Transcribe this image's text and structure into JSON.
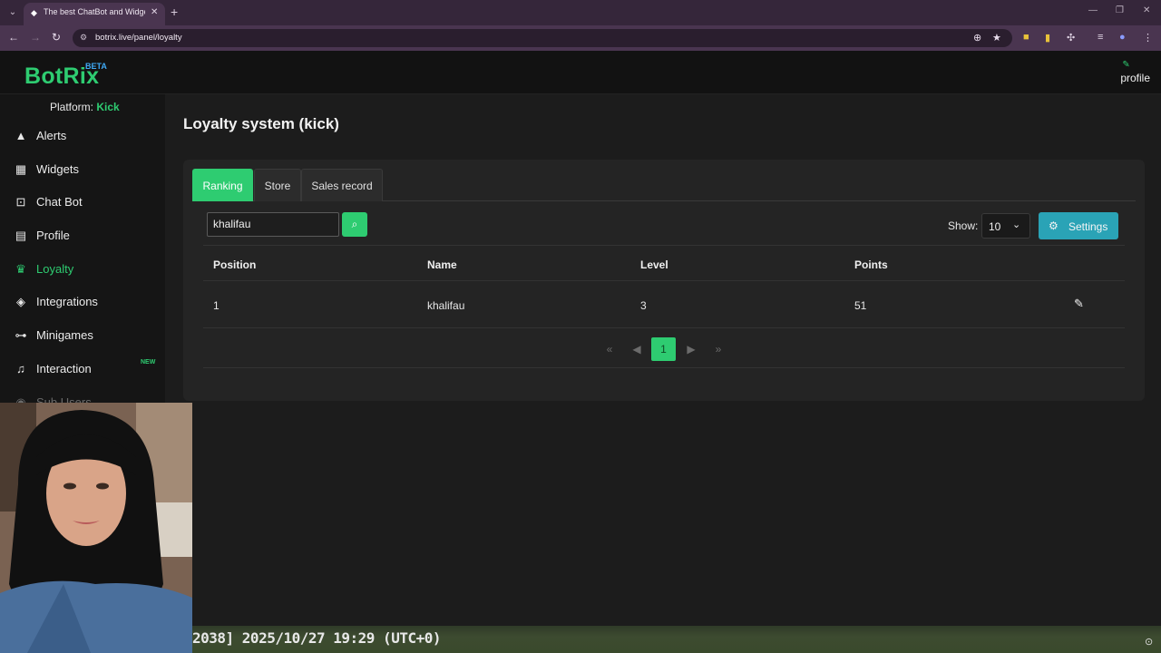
{
  "browser": {
    "tab_title": "The best ChatBot and Widgets",
    "url": "botrix.live/panel/loyalty"
  },
  "app": {
    "logo": "BotRix",
    "beta": "BETA",
    "profile_label": "profile"
  },
  "sidebar": {
    "platform_label": "Platform:",
    "platform_value": "Kick",
    "items": [
      {
        "label": "Alerts",
        "icon": "warning-icon"
      },
      {
        "label": "Widgets",
        "icon": "grid-icon"
      },
      {
        "label": "Chat Bot",
        "icon": "robot-icon"
      },
      {
        "label": "Profile",
        "icon": "id-card-icon"
      },
      {
        "label": "Loyalty",
        "icon": "trophy-icon",
        "active": true
      },
      {
        "label": "Integrations",
        "icon": "cube-icon"
      },
      {
        "label": "Minigames",
        "icon": "gamepad-icon"
      },
      {
        "label": "Interaction",
        "icon": "music-icon",
        "badge": "NEW"
      },
      {
        "label": "Sub Users",
        "icon": "users-icon"
      }
    ]
  },
  "main": {
    "title": "Loyalty system (kick)",
    "tabs": [
      {
        "label": "Ranking",
        "active": true
      },
      {
        "label": "Store"
      },
      {
        "label": "Sales record"
      }
    ],
    "search_value": "khalifau",
    "show_label": "Show:",
    "show_value": "10",
    "settings_label": "Settings",
    "table": {
      "columns": [
        "Position",
        "Name",
        "Level",
        "Points"
      ],
      "rows": [
        {
          "position": "1",
          "name": "khalifau",
          "level": "3",
          "points": "51"
        }
      ]
    },
    "pagination": {
      "current_page": "1"
    }
  },
  "overlay": {
    "timestamp": "2038] 2025/10/27 19:29 (UTC+0)"
  },
  "colors": {
    "accent": "#2ecc71",
    "settings": "#2aa3b6",
    "beta": "#3fa9f5"
  }
}
